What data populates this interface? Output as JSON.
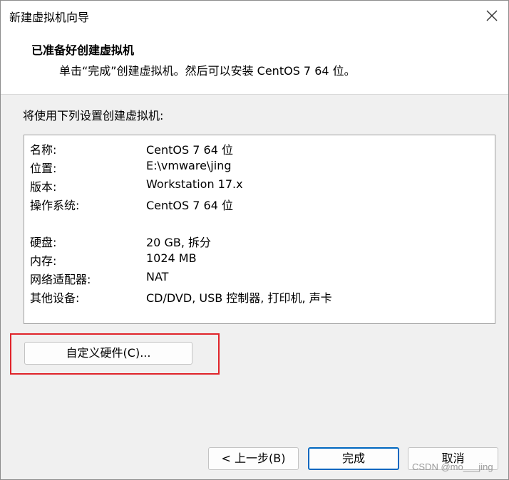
{
  "window": {
    "title": "新建虚拟机向导"
  },
  "header": {
    "title": "已准备好创建虚拟机",
    "subtitle": "单击“完成”创建虚拟机。然后可以安装 CentOS 7 64 位。"
  },
  "summary": {
    "label": "将使用下列设置创建虚拟机:",
    "rows": [
      {
        "key": "名称:",
        "value": "CentOS 7 64 位"
      },
      {
        "key": "位置:",
        "value": "E:\\vmware\\jing"
      },
      {
        "key": "版本:",
        "value": "Workstation 17.x"
      },
      {
        "key": "操作系统:",
        "value": "CentOS 7 64 位"
      },
      {
        "key": "硬盘:",
        "value": "20 GB, 拆分"
      },
      {
        "key": "内存:",
        "value": "1024 MB"
      },
      {
        "key": "网络适配器:",
        "value": "NAT"
      },
      {
        "key": "其他设备:",
        "value": "CD/DVD, USB 控制器, 打印机, 声卡"
      }
    ]
  },
  "buttons": {
    "customize_hardware": "自定义硬件(C)...",
    "back": "< 上一步(B)",
    "finish": "完成",
    "cancel": "取消"
  },
  "icons": {
    "close": "close-icon"
  },
  "colors": {
    "highlight": "#e0242a",
    "primary_border": "#0067c0"
  },
  "watermark": "CSDN @mo___jing"
}
